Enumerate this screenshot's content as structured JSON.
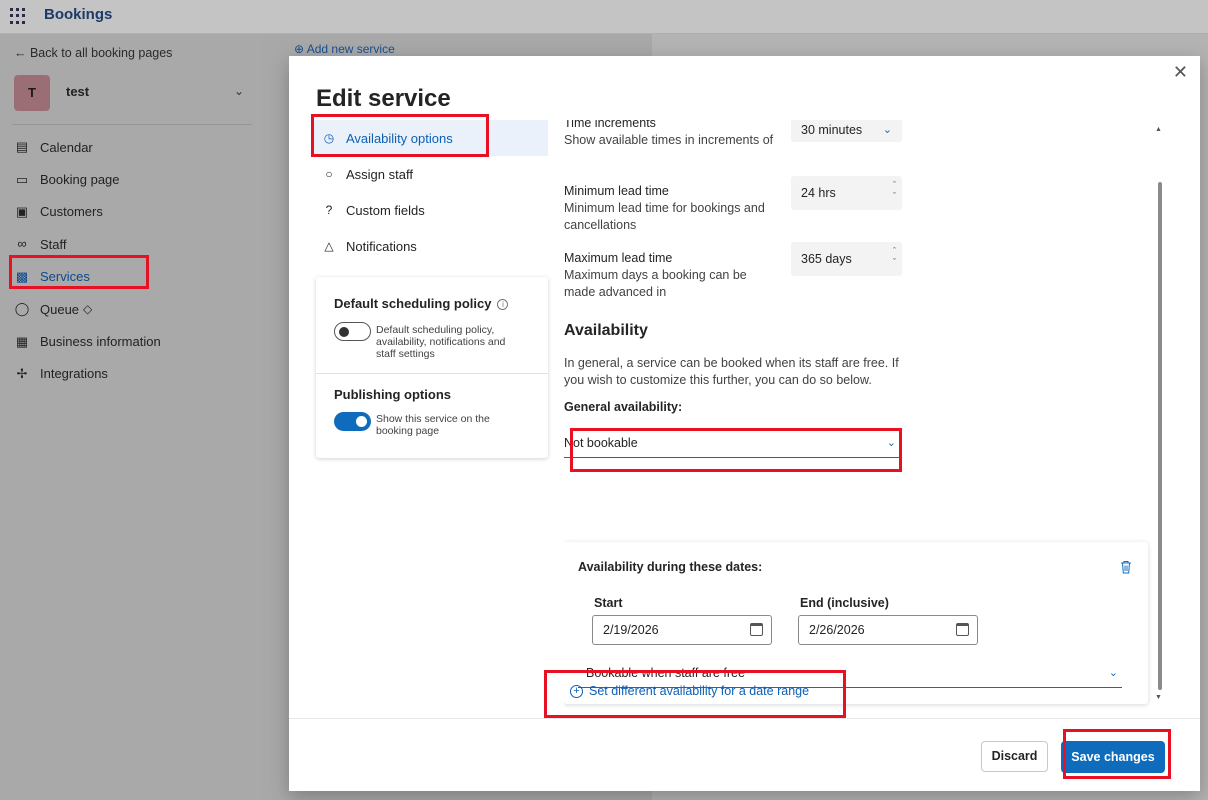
{
  "app": {
    "title": "Bookings",
    "back_link": "← Back to all booking pages",
    "account_initial": "T",
    "account_name": "test",
    "add_service_label": "⊕ Add new service"
  },
  "nav": {
    "items": [
      {
        "label": "Calendar",
        "icon": "calendar-icon"
      },
      {
        "label": "Booking page",
        "icon": "monitor-icon"
      },
      {
        "label": "Customers",
        "icon": "contact-card-icon"
      },
      {
        "label": "Staff",
        "icon": "people-icon"
      },
      {
        "label": "Services",
        "icon": "briefcase-icon",
        "active": true
      },
      {
        "label": "Queue",
        "icon": "queue-icon",
        "badge": "diamond-icon"
      },
      {
        "label": "Business information",
        "icon": "building-icon"
      },
      {
        "label": "Integrations",
        "icon": "integrations-icon"
      }
    ]
  },
  "modal": {
    "title": "Edit service",
    "close_icon": "close-icon",
    "menu": [
      {
        "label": "Availability options",
        "icon": "clock-icon",
        "selected": true
      },
      {
        "label": "Assign staff",
        "icon": "person-icon"
      },
      {
        "label": "Custom fields",
        "icon": "question-circle-icon"
      },
      {
        "label": "Notifications",
        "icon": "bell-icon"
      }
    ],
    "policy": {
      "title": "Default scheduling policy",
      "toggle_text": "Default scheduling policy, availability, notifications and staff settings",
      "toggle_on": false,
      "publishing_title": "Publishing options",
      "publishing_text": "Show this service on the booking page",
      "publishing_on": true
    },
    "time_increments": {
      "label": "Time increments",
      "desc": "Show available times in increments of",
      "value": "30 minutes"
    },
    "min_lead": {
      "label": "Minimum lead time",
      "desc": "Minimum lead time for bookings and cancellations",
      "value": "24 hrs"
    },
    "max_lead": {
      "label": "Maximum lead time",
      "desc": "Maximum days a booking can be made advanced in",
      "value": "365 days"
    },
    "availability": {
      "title": "Availability",
      "desc": "In general, a service can be booked when its staff are free. If you wish to customize this further, you can do so below.",
      "general_label": "General availability:",
      "general_value": "Not bookable",
      "dates_title": "Availability during these dates:",
      "start_label": "Start",
      "start_value": "2/19/2026",
      "end_label": "End (inclusive)",
      "end_value": "2/26/2026",
      "range_value": "Bookable when staff are free",
      "add_range": "Set different availability for a date range"
    },
    "buttons": {
      "discard": "Discard",
      "save": "Save changes"
    }
  },
  "colors": {
    "accent": "#0f6cbd",
    "highlight": "#e81123"
  }
}
